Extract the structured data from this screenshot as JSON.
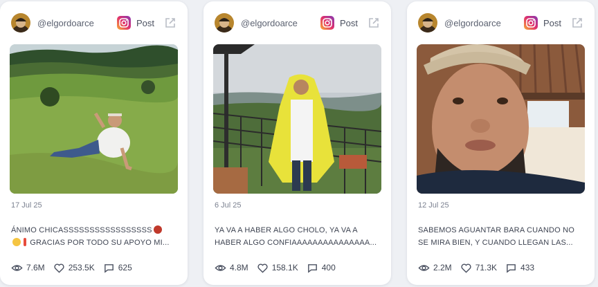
{
  "colors": {
    "card_bg": "#ffffff",
    "page_bg": "#eef0f4",
    "ig_gradient_start": "#f9b234",
    "ig_gradient_end": "#c32aa3"
  },
  "cards": [
    {
      "handle": "@elgordoarce",
      "platform_label": "Post",
      "date": "17 Jul 25",
      "caption_line1": "ÁNIMO CHICASSSSSSSSSSSSSSSSS",
      "caption_line2": "GRACIAS POR TODO SU APOYO MI...",
      "views": "7.6M",
      "likes": "253.5K",
      "comments": "625",
      "photo_desc_icon": "photo-field-icon"
    },
    {
      "handle": "@elgordoarce",
      "platform_label": "Post",
      "date": "6 Jul 25",
      "caption_line1": "YA VA A HABER ALGO CHOLO, YA VA A",
      "caption_line2": "HABER ALGO CONFIAAAAAAAAAAAAAAA...",
      "views": "4.8M",
      "likes": "158.1K",
      "comments": "400",
      "photo_desc_icon": "photo-balcony-icon"
    },
    {
      "handle": "@elgordoarce",
      "platform_label": "Post",
      "date": "12 Jul 25",
      "caption_line1": "SABEMOS AGUANTAR BARA CUANDO NO",
      "caption_line2": "SE MIRA BIEN, Y CUANDO LLEGAN LAS...",
      "views": "2.2M",
      "likes": "71.3K",
      "comments": "433",
      "photo_desc_icon": "photo-selfie-icon"
    }
  ]
}
